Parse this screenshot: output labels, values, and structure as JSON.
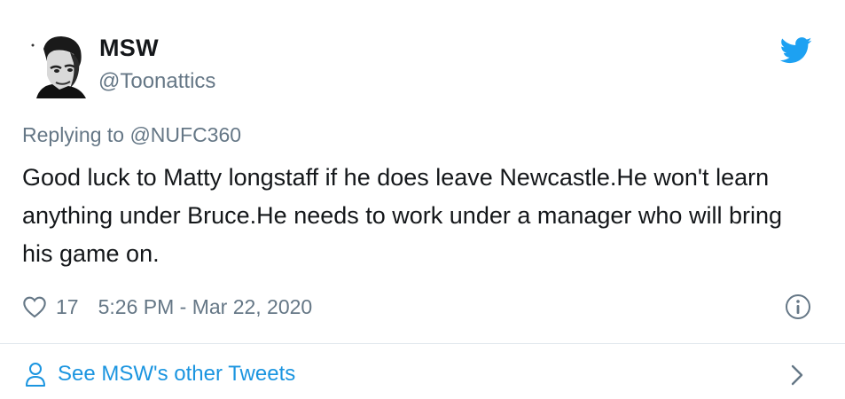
{
  "tweet": {
    "display_name": "MSW",
    "handle": "@Toonattics",
    "replying_to": "Replying to @NUFC360",
    "text": "Good luck to Matty longstaff if he does leave Newcastle.He won't learn anything under Bruce.He needs to work under a manager who will bring his game on.",
    "like_count": "17",
    "timestamp": "5:26 PM - Mar 22, 2020"
  },
  "footer": {
    "see_more": "See MSW's other Tweets"
  },
  "icons": {
    "brand": "twitter-bird-icon",
    "like": "heart-icon",
    "info": "info-icon",
    "person": "person-icon",
    "chevron": "chevron-right-icon"
  },
  "colors": {
    "brand_blue": "#1da1f2",
    "link_blue": "#1b95e0",
    "muted_gray": "#657786",
    "text": "#14171a",
    "divider": "#e1e8ed"
  }
}
